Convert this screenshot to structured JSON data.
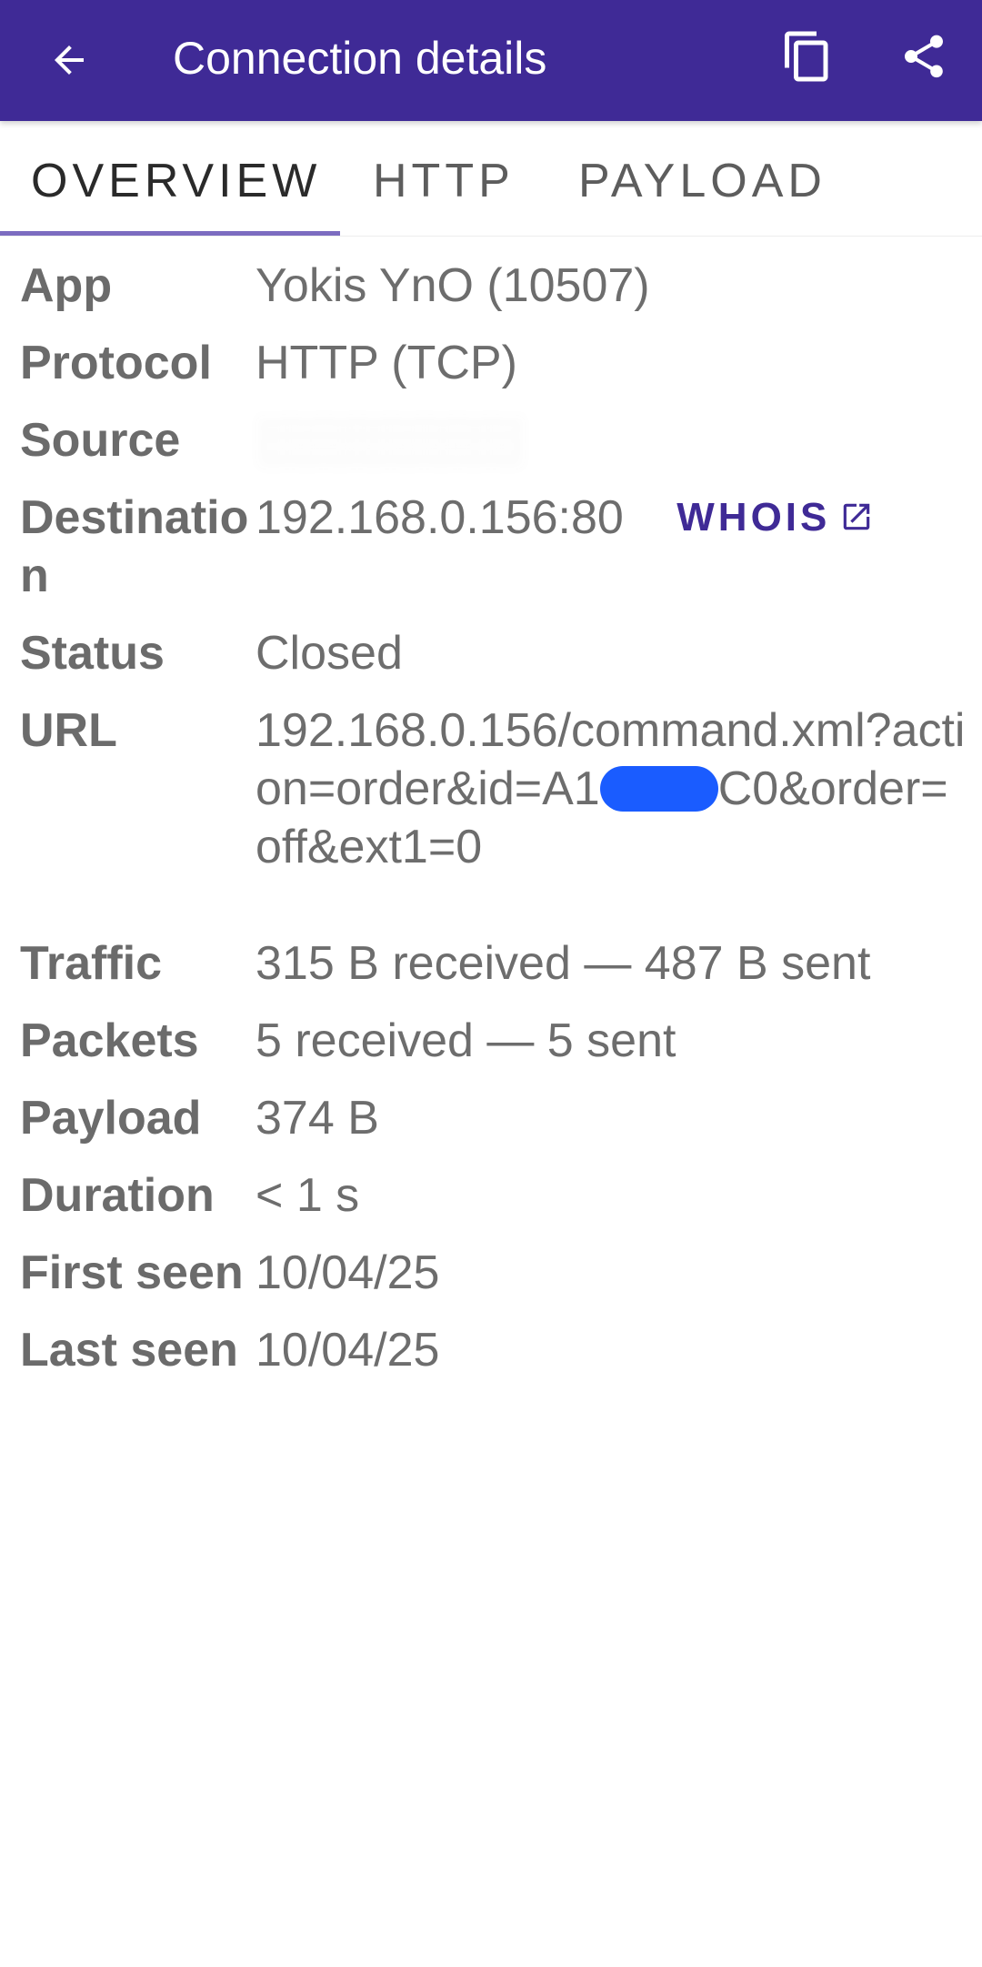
{
  "appbar": {
    "title": "Connection details",
    "icons": {
      "back": "arrow-back-icon",
      "copy": "copy-icon",
      "share": "share-icon"
    },
    "background": "#3f2a96"
  },
  "tabs": [
    {
      "label": "OVERVIEW",
      "active": true
    },
    {
      "label": "HTTP",
      "active": false
    },
    {
      "label": "PAYLOAD",
      "active": false
    }
  ],
  "details": {
    "app": {
      "label": "App",
      "value": "Yokis YnO (10507)"
    },
    "protocol": {
      "label": "Protocol",
      "value": "HTTP (TCP)"
    },
    "source": {
      "label": "Source",
      "value": ""
    },
    "destination": {
      "label": "Destination",
      "value": "192.168.0.156:80",
      "link": "WHOIS",
      "link_icon": "open-in-new-icon"
    },
    "status": {
      "label": "Status",
      "value": "Closed"
    },
    "url": {
      "label": "URL",
      "prefix": "192.168.0.156/command.xml?action=order&id=A1",
      "suffix": "C0&order=off&ext1=0"
    },
    "traffic": {
      "label": "Traffic",
      "value": "315 B received — 487 B sent"
    },
    "packets": {
      "label": "Packets",
      "value": "5 received — 5 sent"
    },
    "payload": {
      "label": "Payload",
      "value": "374 B"
    },
    "duration": {
      "label": "Duration",
      "value": "< 1 s"
    },
    "first_seen": {
      "label": "First seen",
      "value": "10/04/25"
    },
    "last_seen": {
      "label": "Last seen",
      "value": "10/04/25"
    }
  },
  "colors": {
    "accent": "#3f2a96",
    "indicator": "#7c6cc0",
    "redaction": "#1a5cff"
  }
}
